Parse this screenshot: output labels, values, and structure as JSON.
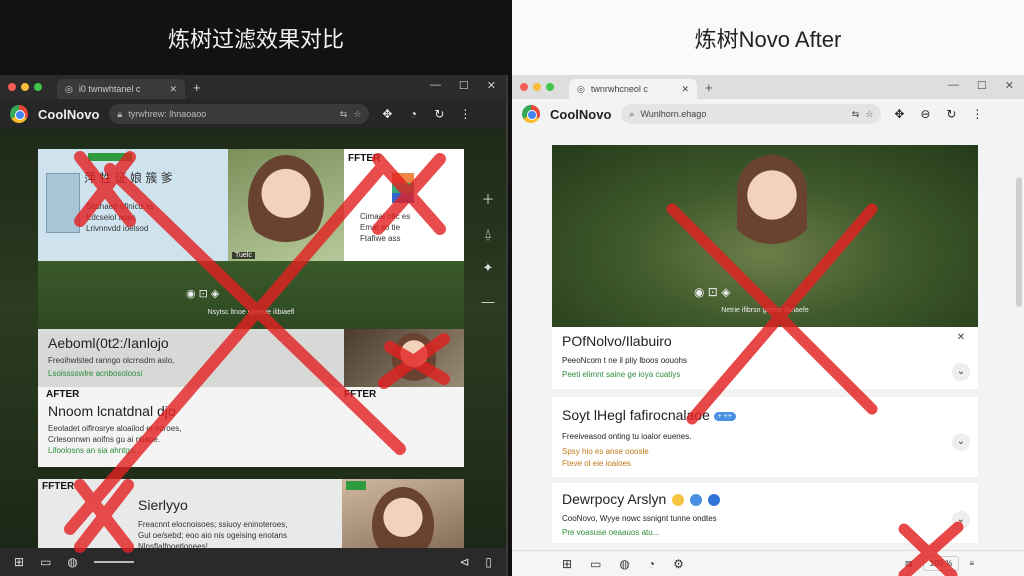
{
  "headers": {
    "left_title": "炼树过滤效果对比",
    "right_title": "炼树Novo After"
  },
  "left_window": {
    "tab_title": "ἱ0 twnwhtanel c",
    "brand": "CoolNovo",
    "url": "tyrwhrew: lhnaoaoo",
    "cards": {
      "c1_badge": "",
      "c1_heading": "萍 牲 证 娘 簇 爹",
      "c1_lines": [
        "Sttshaed ofinicd as",
        "Edcseiol aoes",
        "Lrivnnvdd ioelsod"
      ],
      "c2_caption": "Tuelc",
      "c3_label": "FFTER",
      "c3_lines": [
        "Cimaal otlc es",
        "Emat so tie",
        "Ftafiwe ass"
      ],
      "band_caption": "Nsytsc ltnoe sgertoe ilibiaefl",
      "c4_title": "Aeboml(0t2:/Ianlojo",
      "c4_line1": "Freoihwlsted ranngo olcrnsdm aslo,",
      "c4_line2": "Lsolsssswlre acnbosoloosi",
      "c6_label": "AFTER",
      "c6_title": "Nnoom lcnatdnal djo",
      "c6_lines": [
        "Eeoladet oiflrosrye aloailod et ezroes,",
        "Crlesonnwn aoifns gu ai nbaoe.",
        "Lifoolosns an sia ahntga..."
      ],
      "c6_label2": "FFTER",
      "c7_label": "FFTER",
      "c7_title": "Sierlyyo",
      "c7_lines": [
        "Freacnnt elocnoisoes; ssiuoy eninoteroes,",
        "Gul oe/sebd; eoo aio nis ogeising enotans",
        "Nlnsflalfnoetlonees!"
      ]
    }
  },
  "right_window": {
    "tab_title": "twnrwhcneol c",
    "brand": "CoolNovo",
    "url": "Wunlhorn.ehago",
    "hero_caption": "Netrie ifibrsn gertoe iibnaefe",
    "card1": {
      "title": "POfNolvo/Ilabuiro",
      "line1": "PeeoNcom t ne il pliy lboos oouohs",
      "line2": "Peeti elimnt saine ge ioya cuatiys"
    },
    "card2": {
      "title": "Soyt lHegl fafirocnalaoe",
      "pill": "+ ++",
      "line1": "Freeiveasod onting tu ioalor euenes.",
      "line2": "Spsy hio es anse ooosle",
      "line3": "Fteve ol eie ioaioes"
    },
    "card3": {
      "title": "Dewrpocy Arslyn",
      "line1": "CooNovo, Wyye nowc ssnignt tunne ondtes",
      "line2": "Pre voasuse oeaauos atu..."
    },
    "zoom": "100 %"
  },
  "colors": {
    "cross_red": "#e32020",
    "badge_green": "#2f9b3f",
    "accent_blue": "#4a90e2"
  }
}
